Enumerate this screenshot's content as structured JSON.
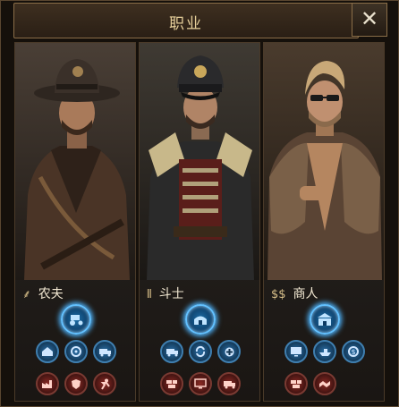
{
  "window": {
    "title": "职业",
    "close_label": "✕"
  },
  "professions": [
    {
      "name": "农夫",
      "glyph": "⸙",
      "glyph_icon": "wheat-icon"
    },
    {
      "name": "斗士",
      "glyph": "⦀",
      "glyph_icon": "bullets-icon"
    },
    {
      "name": "商人",
      "glyph": "$$",
      "glyph_icon": "money-icon"
    }
  ],
  "colors": {
    "accent_gold": "#e6cf9a",
    "skill_blue": "#1d6fa8",
    "skill_red": "#8a2a24"
  }
}
